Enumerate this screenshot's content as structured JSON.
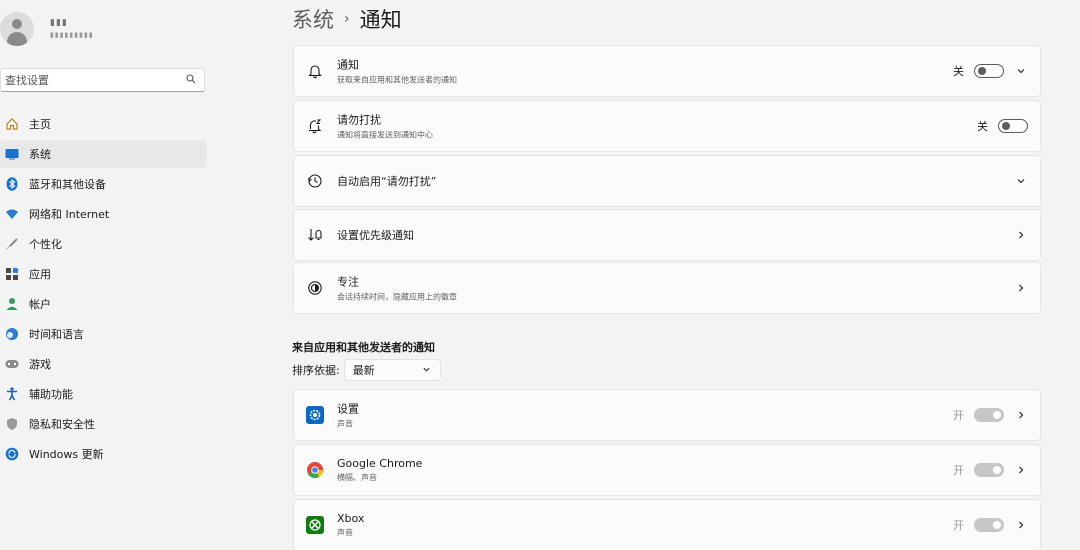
{
  "profile": {
    "name": "▮▮▮",
    "subtitle": "▮▮▮▮▮▮▮▮▮"
  },
  "search": {
    "placeholder": "查找设置"
  },
  "nav": {
    "items": [
      {
        "label": "主页",
        "icon": "home-icon"
      },
      {
        "label": "系统",
        "icon": "system-icon",
        "active": true
      },
      {
        "label": "蓝牙和其他设备",
        "icon": "bluetooth-icon"
      },
      {
        "label": "网络和 Internet",
        "icon": "wifi-icon"
      },
      {
        "label": "个性化",
        "icon": "brush-icon"
      },
      {
        "label": "应用",
        "icon": "apps-icon"
      },
      {
        "label": "帐户",
        "icon": "account-icon"
      },
      {
        "label": "时间和语言",
        "icon": "globe-clock-icon"
      },
      {
        "label": "游戏",
        "icon": "gamepad-icon"
      },
      {
        "label": "辅助功能",
        "icon": "accessibility-icon"
      },
      {
        "label": "隐私和安全性",
        "icon": "shield-icon"
      },
      {
        "label": "Windows 更新",
        "icon": "update-icon"
      }
    ]
  },
  "header": {
    "parent": "系统",
    "separator": "›",
    "title": "通知"
  },
  "settings": [
    {
      "title": "通知",
      "subtitle": "获取来自应用和其他发送者的通知",
      "icon": "bell-icon",
      "state": "关"
    },
    {
      "title": "请勿打扰",
      "subtitle": "通知将直接发送到通知中心",
      "icon": "bell-snooze-icon",
      "state": "关"
    },
    {
      "title": "自动启用“请勿打扰”",
      "icon": "clock-icon"
    },
    {
      "title": "设置优先级通知",
      "icon": "priority-icon"
    },
    {
      "title": "专注",
      "subtitle": "会话持续时间，隐藏应用上的徽章",
      "icon": "focus-icon"
    }
  ],
  "apps_section": {
    "heading": "来自应用和其他发送者的通知",
    "sort_label": "排序依据:",
    "sort_value": "最新"
  },
  "apps": [
    {
      "name": "设置",
      "subtitle": "声音",
      "state": "开",
      "icon": "settings-gear-icon",
      "color": "#0a67c2"
    },
    {
      "name": "Google Chrome",
      "subtitle": "横幅、声音",
      "state": "开",
      "icon": "chrome-icon",
      "color": "#ea4335"
    },
    {
      "name": "Xbox",
      "subtitle": "声音",
      "state": "开",
      "icon": "xbox-icon",
      "color": "#107c10"
    }
  ],
  "colors": {
    "accent": "#0067c0",
    "background": "#f3f3f3",
    "card": "#fbfbfb"
  }
}
